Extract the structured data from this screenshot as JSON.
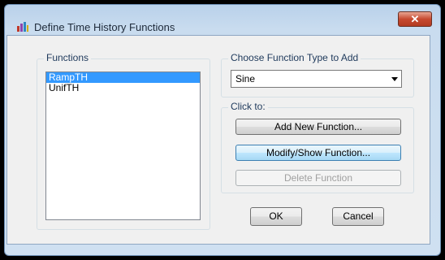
{
  "window": {
    "title": "Define Time History Functions",
    "close_symbol": "✕"
  },
  "functions_group": {
    "label": "Functions",
    "items": [
      "RampTH",
      "UnifTH"
    ],
    "selected_index": 0
  },
  "type_group": {
    "label": "Choose  Function Type to Add",
    "selected_value": "Sine"
  },
  "actions_group": {
    "label": "Click to:",
    "add_label": "Add New Function...",
    "modify_label": "Modify/Show Function...",
    "delete_label": "Delete Function"
  },
  "footer": {
    "ok_label": "OK",
    "cancel_label": "Cancel"
  },
  "colors": {
    "selection": "#3399ff",
    "close_button": "#c74a30",
    "title_bar": "#b9d1ea"
  },
  "icons": [
    "app-icon",
    "close-icon",
    "dropdown-arrow-icon"
  ]
}
